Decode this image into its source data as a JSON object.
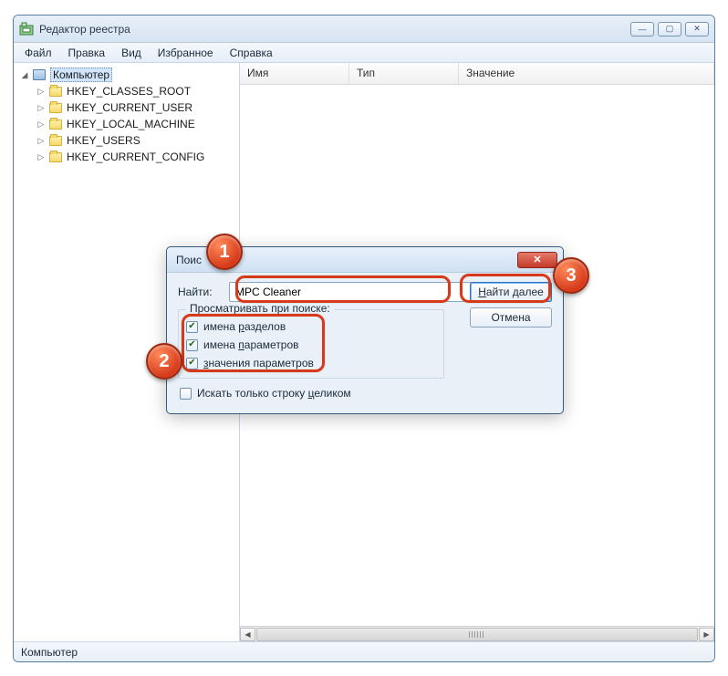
{
  "window": {
    "title": "Редактор реестра"
  },
  "menu": {
    "file": "Файл",
    "edit": "Правка",
    "view": "Вид",
    "favorites": "Избранное",
    "help": "Справка"
  },
  "tree": {
    "root": "Компьютер",
    "keys": [
      "HKEY_CLASSES_ROOT",
      "HKEY_CURRENT_USER",
      "HKEY_LOCAL_MACHINE",
      "HKEY_USERS",
      "HKEY_CURRENT_CONFIG"
    ]
  },
  "columns": {
    "name": "Имя",
    "type": "Тип",
    "value": "Значение"
  },
  "statusbar": "Компьютер",
  "dialog": {
    "title": "Поис",
    "find_label": "Найти:",
    "find_value": "MPC Cleaner",
    "group_label": "Просматривать при поиске:",
    "opt_keys_prefix": "имена ",
    "opt_keys_u": "р",
    "opt_keys_suffix": "азделов",
    "opt_values_prefix": "имена ",
    "opt_values_u": "п",
    "opt_values_suffix": "араметров",
    "opt_data_u": "з",
    "opt_data_suffix": "начения параметров",
    "opt_whole_prefix": "Искать только строку ",
    "opt_whole_u": "ц",
    "opt_whole_suffix": "еликом",
    "btn_find_u": "Н",
    "btn_find_suffix": "айти далее",
    "btn_cancel": "Отмена"
  },
  "annotations": {
    "b1": "1",
    "b2": "2",
    "b3": "3"
  }
}
